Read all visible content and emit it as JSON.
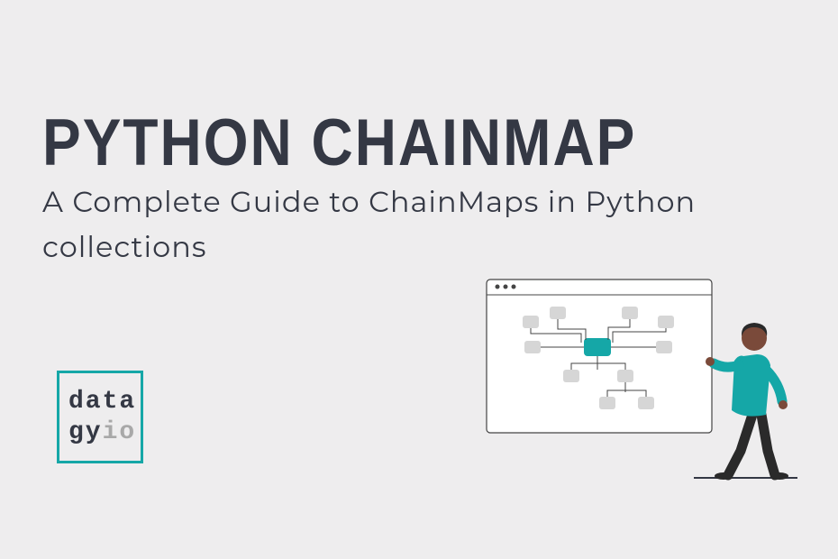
{
  "title": "PYTHON CHAINMAP",
  "subtitle": "A Complete Guide to ChainMaps in Python collections",
  "logo": {
    "line1": "data",
    "line2a": "gy",
    "line2b": "io"
  },
  "colors": {
    "accent": "#15a7a7",
    "text": "#343844",
    "bg": "#eeedee"
  }
}
